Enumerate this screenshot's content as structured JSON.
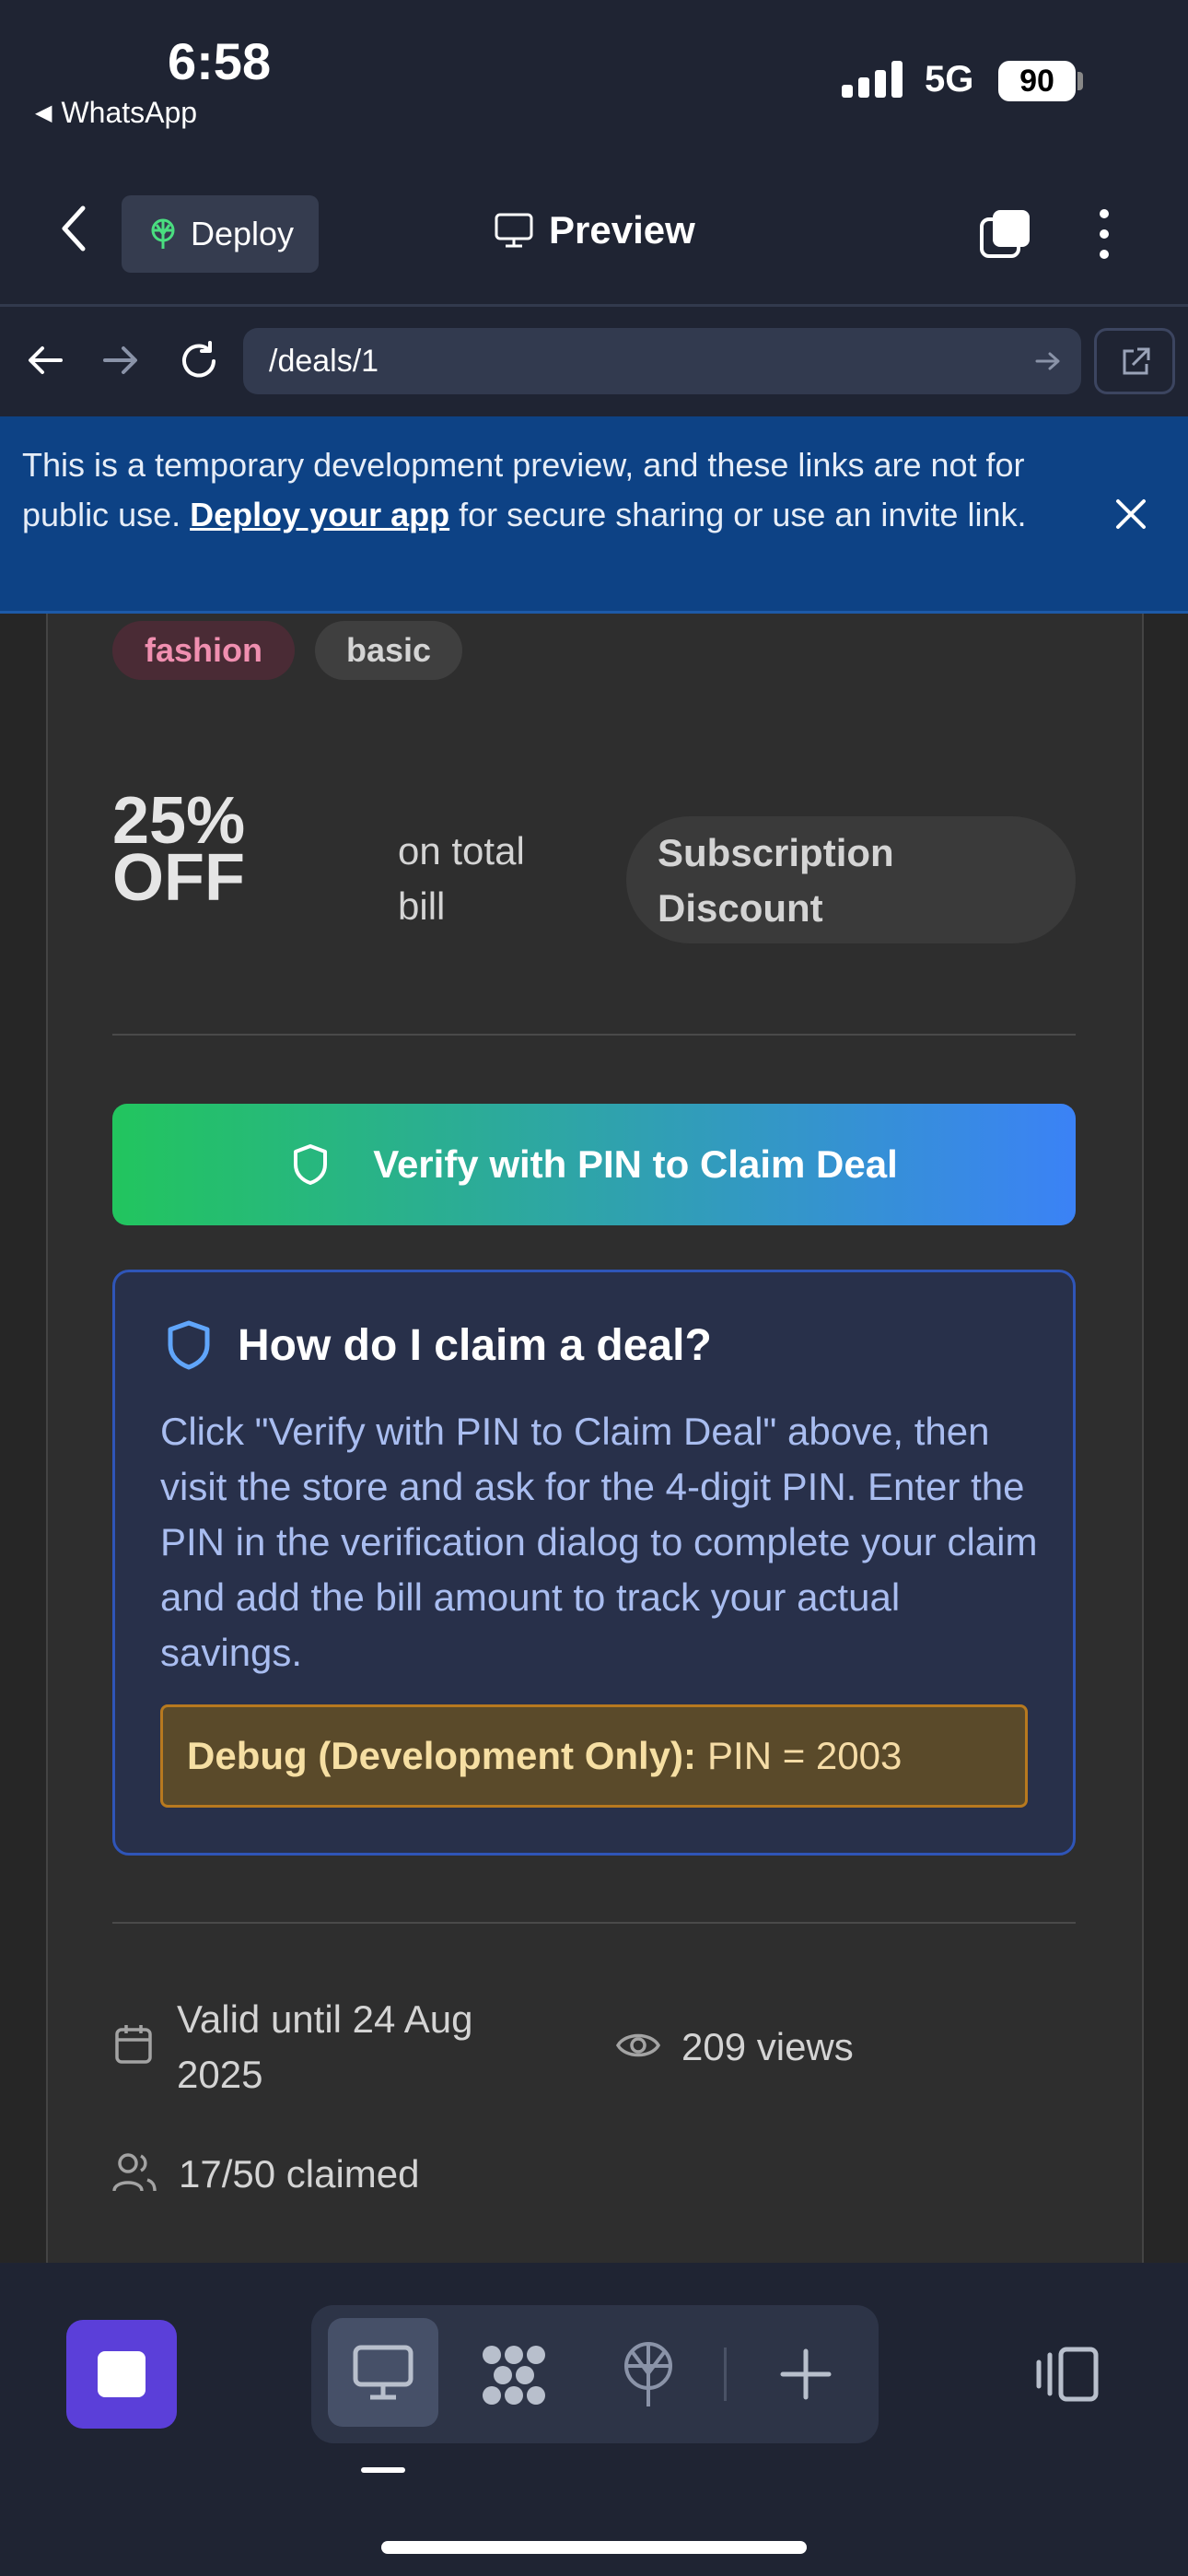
{
  "status_bar": {
    "time": "6:58",
    "back_app": "WhatsApp",
    "network": "5G",
    "battery": "90"
  },
  "nav": {
    "deploy_label": "Deploy",
    "preview_label": "Preview"
  },
  "url_bar": {
    "path": "/deals/1"
  },
  "banner": {
    "text_before": "This is a temporary development preview, and these links are not for public use. ",
    "link": "Deploy your app",
    "text_after": " for secure sharing or use an invite link."
  },
  "deal": {
    "tags": [
      "fashion",
      "basic"
    ],
    "discount_line1": "25%",
    "discount_line2": "OFF",
    "scope_line1": "on total",
    "scope_line2": "bill",
    "type_line1": "Subscription",
    "type_line2": "Discount",
    "claim_button": "Verify with PIN to Claim Deal",
    "howto": {
      "title": "How do I claim a deal?",
      "body": "Click \"Verify with PIN to Claim Deal\" above, then visit the store and ask for the 4-digit PIN. Enter the PIN in the verification dialog to complete your claim and add the bill amount to track your actual savings.",
      "debug_label": "Debug (Development Only):",
      "debug_value": "PIN = 2003"
    },
    "valid_line1": "Valid until 24 Aug",
    "valid_line2": "2025",
    "views": "209 views",
    "claimed": "17/50 claimed"
  },
  "colors": {
    "accent_green": "#22c55e",
    "accent_blue": "#3b82f6",
    "banner_bg": "#0d4285",
    "tag_fashion": "#f08fb0"
  }
}
